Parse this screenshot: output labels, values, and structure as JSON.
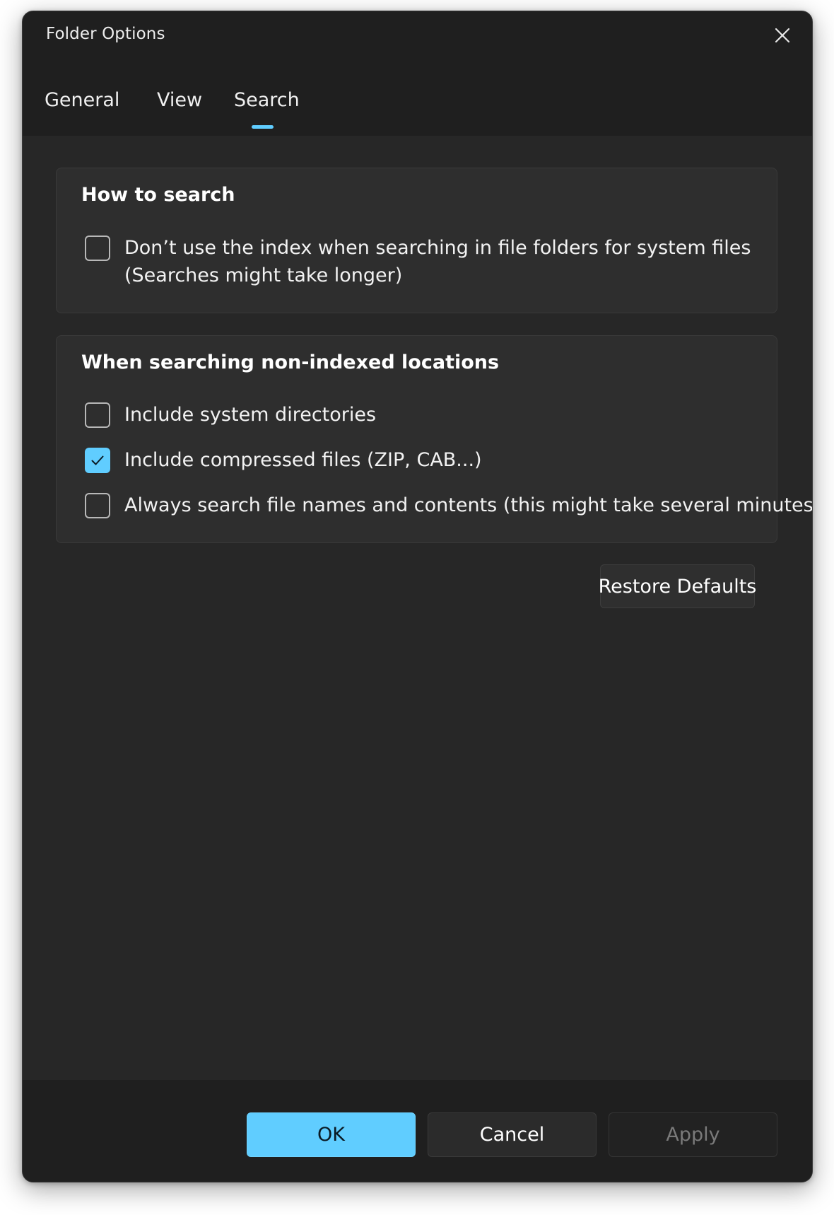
{
  "window": {
    "title": "Folder Options"
  },
  "tabs": [
    {
      "label": "General",
      "active": false
    },
    {
      "label": "View",
      "active": false
    },
    {
      "label": "Search",
      "active": true
    }
  ],
  "how_to_search": {
    "title": "How to search",
    "options": [
      {
        "label_line1": "Don’t use the index when searching in file folders for system files",
        "label_line2": "(Searches might take longer)",
        "checked": false
      }
    ]
  },
  "non_indexed": {
    "title": "When searching non-indexed locations",
    "options": [
      {
        "label": "Include system directories",
        "checked": false
      },
      {
        "label": "Include compressed files (ZIP, CAB...)",
        "checked": true
      },
      {
        "label": "Always search file names and contents (this might take several minutes)",
        "checked": false
      }
    ]
  },
  "restore_defaults_label": "Restore Defaults",
  "footer": {
    "ok_label": "OK",
    "cancel_label": "Cancel",
    "apply_label": "Apply",
    "apply_enabled": false
  },
  "colors": {
    "accent": "#60cdff",
    "window_bg": "#1f1f1f",
    "content_bg": "#272727",
    "group_bg": "#2e2e2e"
  },
  "icons": {
    "close": "close-icon",
    "check": "checkmark-icon"
  }
}
